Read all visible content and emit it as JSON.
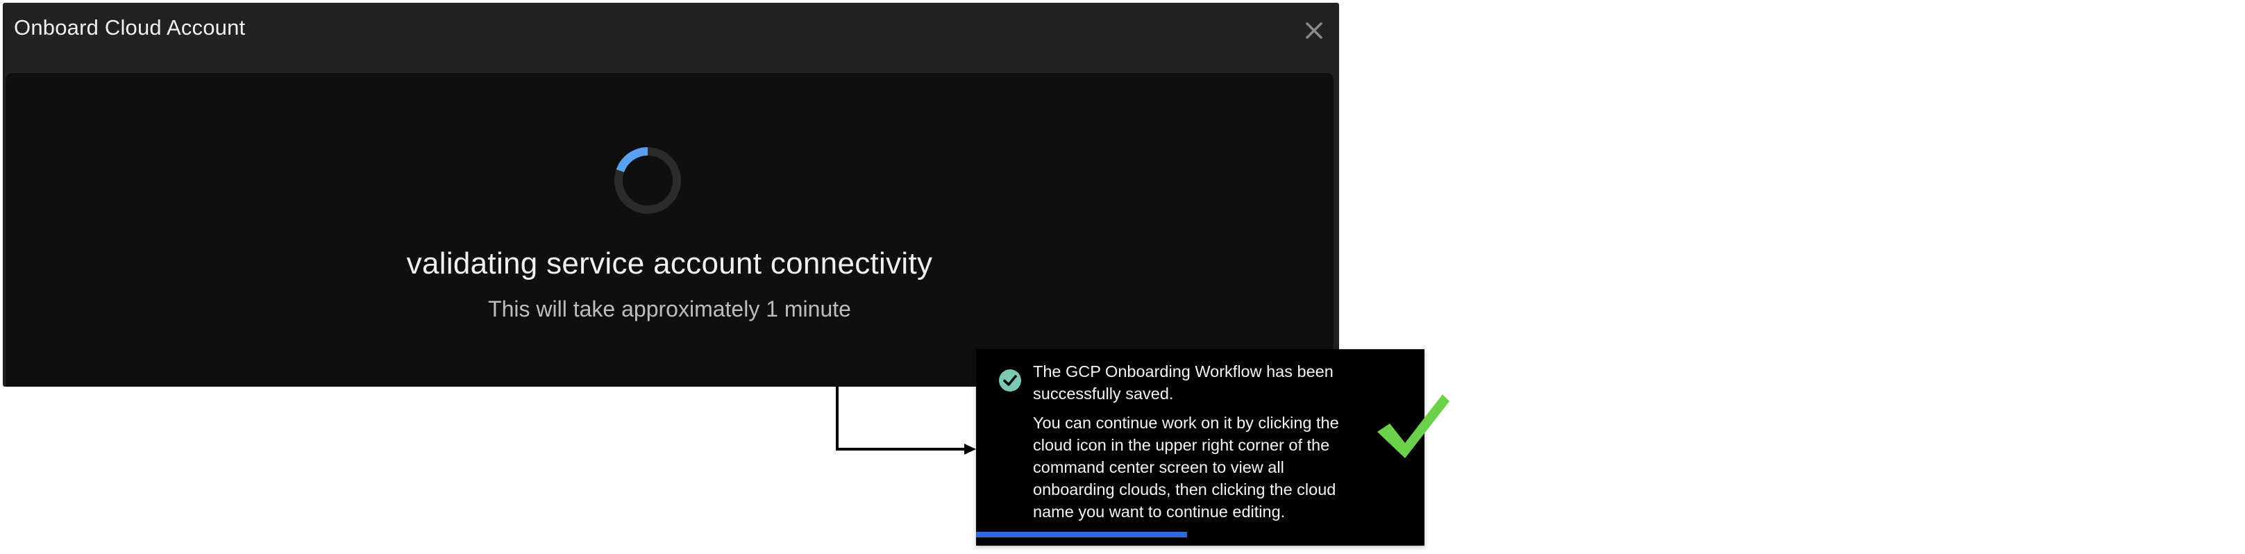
{
  "modal": {
    "title": "Onboard Cloud Account",
    "close_icon": "close-icon",
    "status_title": "validating service account connectivity",
    "status_subtitle": "This will take approximately 1 minute",
    "spinner_icon": "loading-spinner-icon"
  },
  "toast": {
    "status_icon": "check-circle-icon",
    "message_line_1": "The GCP Onboarding Workflow has been successfully saved.",
    "message_line_2": "You can continue work on it by clicking the cloud icon in the upper right corner of the command center screen to view all onboarding clouds, then clicking the cloud name you want to continue editing.",
    "progress_fraction": 0.47
  },
  "annotation": {
    "success_icon": "checkmark-icon"
  },
  "colors": {
    "modal_header_bg": "#222223",
    "modal_body_bg": "#0f0f10",
    "spinner_accent": "#5a9ff0",
    "toast_bg": "#000000",
    "toast_check": "#7bc9b4",
    "toast_progress": "#2e6bd9",
    "success_check": "#6bd04a"
  }
}
